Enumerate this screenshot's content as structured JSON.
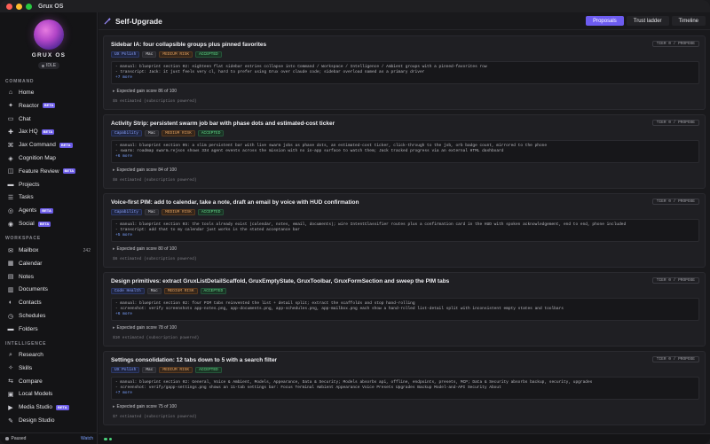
{
  "window": {
    "title": "Grux OS"
  },
  "brand": {
    "name": "GRUX OS",
    "status": "IDLE"
  },
  "sidebar": {
    "command_label": "COMMAND",
    "command": [
      {
        "label": "Home",
        "icon": "home-icon",
        "beta": ""
      },
      {
        "label": "Reactor",
        "icon": "reactor-icon",
        "beta": "BETA"
      },
      {
        "label": "Chat",
        "icon": "chat-icon",
        "beta": ""
      },
      {
        "label": "Jax HQ",
        "icon": "jax-hq-icon",
        "beta": "BETA"
      },
      {
        "label": "Jax Command",
        "icon": "jax-command-icon",
        "beta": "BETA"
      },
      {
        "label": "Cognition Map",
        "icon": "cognition-map-icon",
        "beta": ""
      },
      {
        "label": "Feature Review",
        "icon": "feature-review-icon",
        "beta": "BETA"
      },
      {
        "label": "Projects",
        "icon": "folder-icon",
        "beta": ""
      },
      {
        "label": "Tasks",
        "icon": "tasks-icon",
        "beta": ""
      },
      {
        "label": "Agents",
        "icon": "agents-icon",
        "beta": "BETA"
      },
      {
        "label": "Social",
        "icon": "social-icon",
        "beta": "BETA"
      }
    ],
    "workspace_label": "WORKSPACE",
    "workspace": [
      {
        "label": "Mailbox",
        "icon": "mailbox-icon",
        "count": "242"
      },
      {
        "label": "Calendar",
        "icon": "calendar-icon",
        "count": ""
      },
      {
        "label": "Notes",
        "icon": "notes-icon",
        "count": ""
      },
      {
        "label": "Documents",
        "icon": "documents-icon",
        "count": ""
      },
      {
        "label": "Contacts",
        "icon": "contacts-icon",
        "count": ""
      },
      {
        "label": "Schedules",
        "icon": "schedules-icon",
        "count": ""
      },
      {
        "label": "Folders",
        "icon": "folder-icon",
        "count": ""
      }
    ],
    "intelligence_label": "INTELLIGENCE",
    "intelligence": [
      {
        "label": "Research",
        "icon": "research-icon",
        "beta": ""
      },
      {
        "label": "Skills",
        "icon": "skills-icon",
        "beta": ""
      },
      {
        "label": "Compare",
        "icon": "compare-icon",
        "beta": ""
      },
      {
        "label": "Local Models",
        "icon": "local-models-icon",
        "beta": ""
      },
      {
        "label": "Media Studio",
        "icon": "media-studio-icon",
        "beta": "BETA"
      },
      {
        "label": "Design Studio",
        "icon": "design-studio-icon",
        "beta": ""
      }
    ],
    "footer": {
      "status": "Paused",
      "action": "Watch"
    }
  },
  "header": {
    "title": "Self-Upgrade",
    "tabs": [
      "Proposals",
      "Trust ladder",
      "Timeline"
    ],
    "active_tab": "Proposals"
  },
  "colors": {
    "accent": "#6d5cf0",
    "accepted": "#63d98a",
    "risk": "#e0a060",
    "link": "#7aa0ff"
  },
  "proposals": [
    {
      "title": "Sidebar IA: four collapsible groups plus pinned favorites",
      "tier": "TIER 0 / PROPOSE",
      "category": "UX Polish",
      "platform": "Mac",
      "risk": "MEDIUM RISK",
      "state": "ACCEPTED",
      "evidence": [
        "- manual: blueprint section 02: eighteen flat sidebar entries collapse into Command / Workspace / Intelligence / Ambient groups with a pinned-favorites row",
        "- transcript: Jack: it just feels very cl, hard to prefer using Grux over claude code; sidebar overload named as a primary driver"
      ],
      "more": "+7 more",
      "gain": "Expected gain score 86 of 100",
      "cost": "$5 estimated (subscription powered)"
    },
    {
      "title": "Activity Strip: persistent swarm job bar with phase dots and estimated-cost ticker",
      "tier": "TIER 0 / PROPOSE",
      "category": "Capability",
      "platform": "Mac",
      "risk": "MEDIUM RISK",
      "state": "ACCEPTED",
      "evidence": [
        "- manual: blueprint section 05: a slim persistent bar with live swarm jobs as phase dots, an estimated-cost ticker, click-through to the job, orb badge count, mirrored to the phone",
        "- swarm: roadmap swarm.rejson shows 334 agent events across the mission with no in-app surface to watch them; Jack tracked progress via an external HTML dashboard"
      ],
      "more": "+6 more",
      "gain": "Expected gain score 84 of 100",
      "cost": "$8 estimated (subscription powered)"
    },
    {
      "title": "Voice-first PIM: add to calendar, take a note, draft an email by voice with HUD confirmation",
      "tier": "TIER 0 / PROPOSE",
      "category": "Capability",
      "platform": "Mac",
      "risk": "MEDIUM RISK",
      "state": "ACCEPTED",
      "evidence": [
        "- manual: blueprint section 03: the tools already exist (calendar, notes, email, documents); wire IntentClassifier routes plus a confirmation card in the HUD with spoken acknowledgement, end to end, phone included",
        "- transcript: add that to my calendar just works is the stated acceptance bar"
      ],
      "more": "+5 more",
      "gain": "Expected gain score 80 of 100",
      "cost": "$6 estimated (subscription powered)"
    },
    {
      "title": "Design primitives: extract GruxListDetailScaffold, GruxEmptyState, GruxToolbar, GruxFormSection and sweep the PIM tabs",
      "tier": "TIER 0 / PROPOSE",
      "category": "Code Health",
      "platform": "Mac",
      "risk": "MEDIUM RISK",
      "state": "ACCEPTED",
      "evidence": [
        "- manual: blueprint section 02: four PIM tabs reinvented the list + detail split; extract the scaffolds and stop hand-rolling",
        "- screenshot: verify screenshots app-notes.png, app-documents.png, app-schedules.png, app-mailbox.png each show a hand-rolled list-detail split with inconsistent empty states and toolbars"
      ],
      "more": "+6 more",
      "gain": "Expected gain score 78 of 100",
      "cost": "$10 estimated (subscription powered)"
    },
    {
      "title": "Settings consolidation: 12 tabs down to 5 with a search filter",
      "tier": "TIER 0 / PROPOSE",
      "category": "UX Polish",
      "platform": "Mac",
      "risk": "MEDIUM RISK",
      "state": "ACCEPTED",
      "evidence": [
        "- manual: blueprint section 02: General, Voice & Ambient, Models, Appearance, Data & Security; Models absorbs api, offline, endpoints, presets, MCP; Data & Security absorbs backup, security, upgrades",
        "- screenshot: verify/gapp-settings.png shows an 11-tab settings bar: Focus Terminal Ambient Appearance Voice Presets Upgrades Backup Model-and-API Security About"
      ],
      "more": "+7 more",
      "gain": "Expected gain score 75 of 100",
      "cost": "$7 estimated (subscription powered)"
    }
  ]
}
